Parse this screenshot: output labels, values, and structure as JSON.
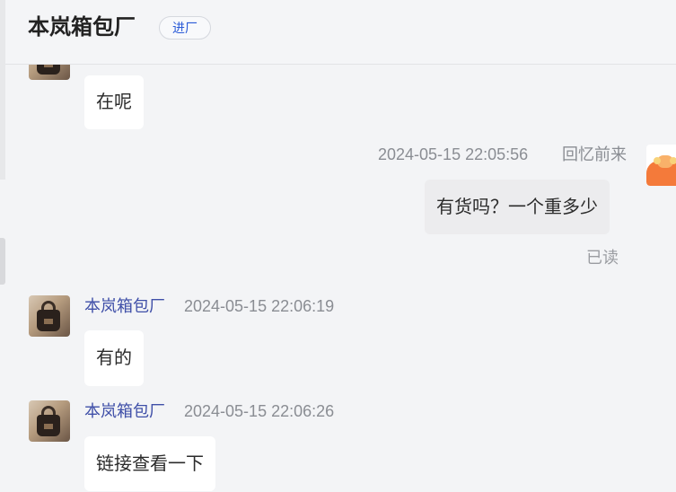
{
  "header": {
    "shop_name": "本岚箱包厂",
    "enter_label": "进厂"
  },
  "messages": [
    {
      "side": "left",
      "text": "在呢"
    },
    {
      "side": "right",
      "time": "2024-05-15 22:05:56",
      "sender": "回忆前来",
      "text": "有货吗？一个重多少",
      "status": "已读"
    },
    {
      "side": "left",
      "sender": "本岚箱包厂",
      "time": "2024-05-15 22:06:19",
      "text": "有的"
    },
    {
      "side": "left",
      "sender": "本岚箱包厂",
      "time": "2024-05-15 22:06:26",
      "text": "链接查看一下"
    }
  ],
  "icons": {
    "shop_avatar": "handbag-avatar-icon",
    "user_avatar": "cartoon-avatar-icon"
  }
}
